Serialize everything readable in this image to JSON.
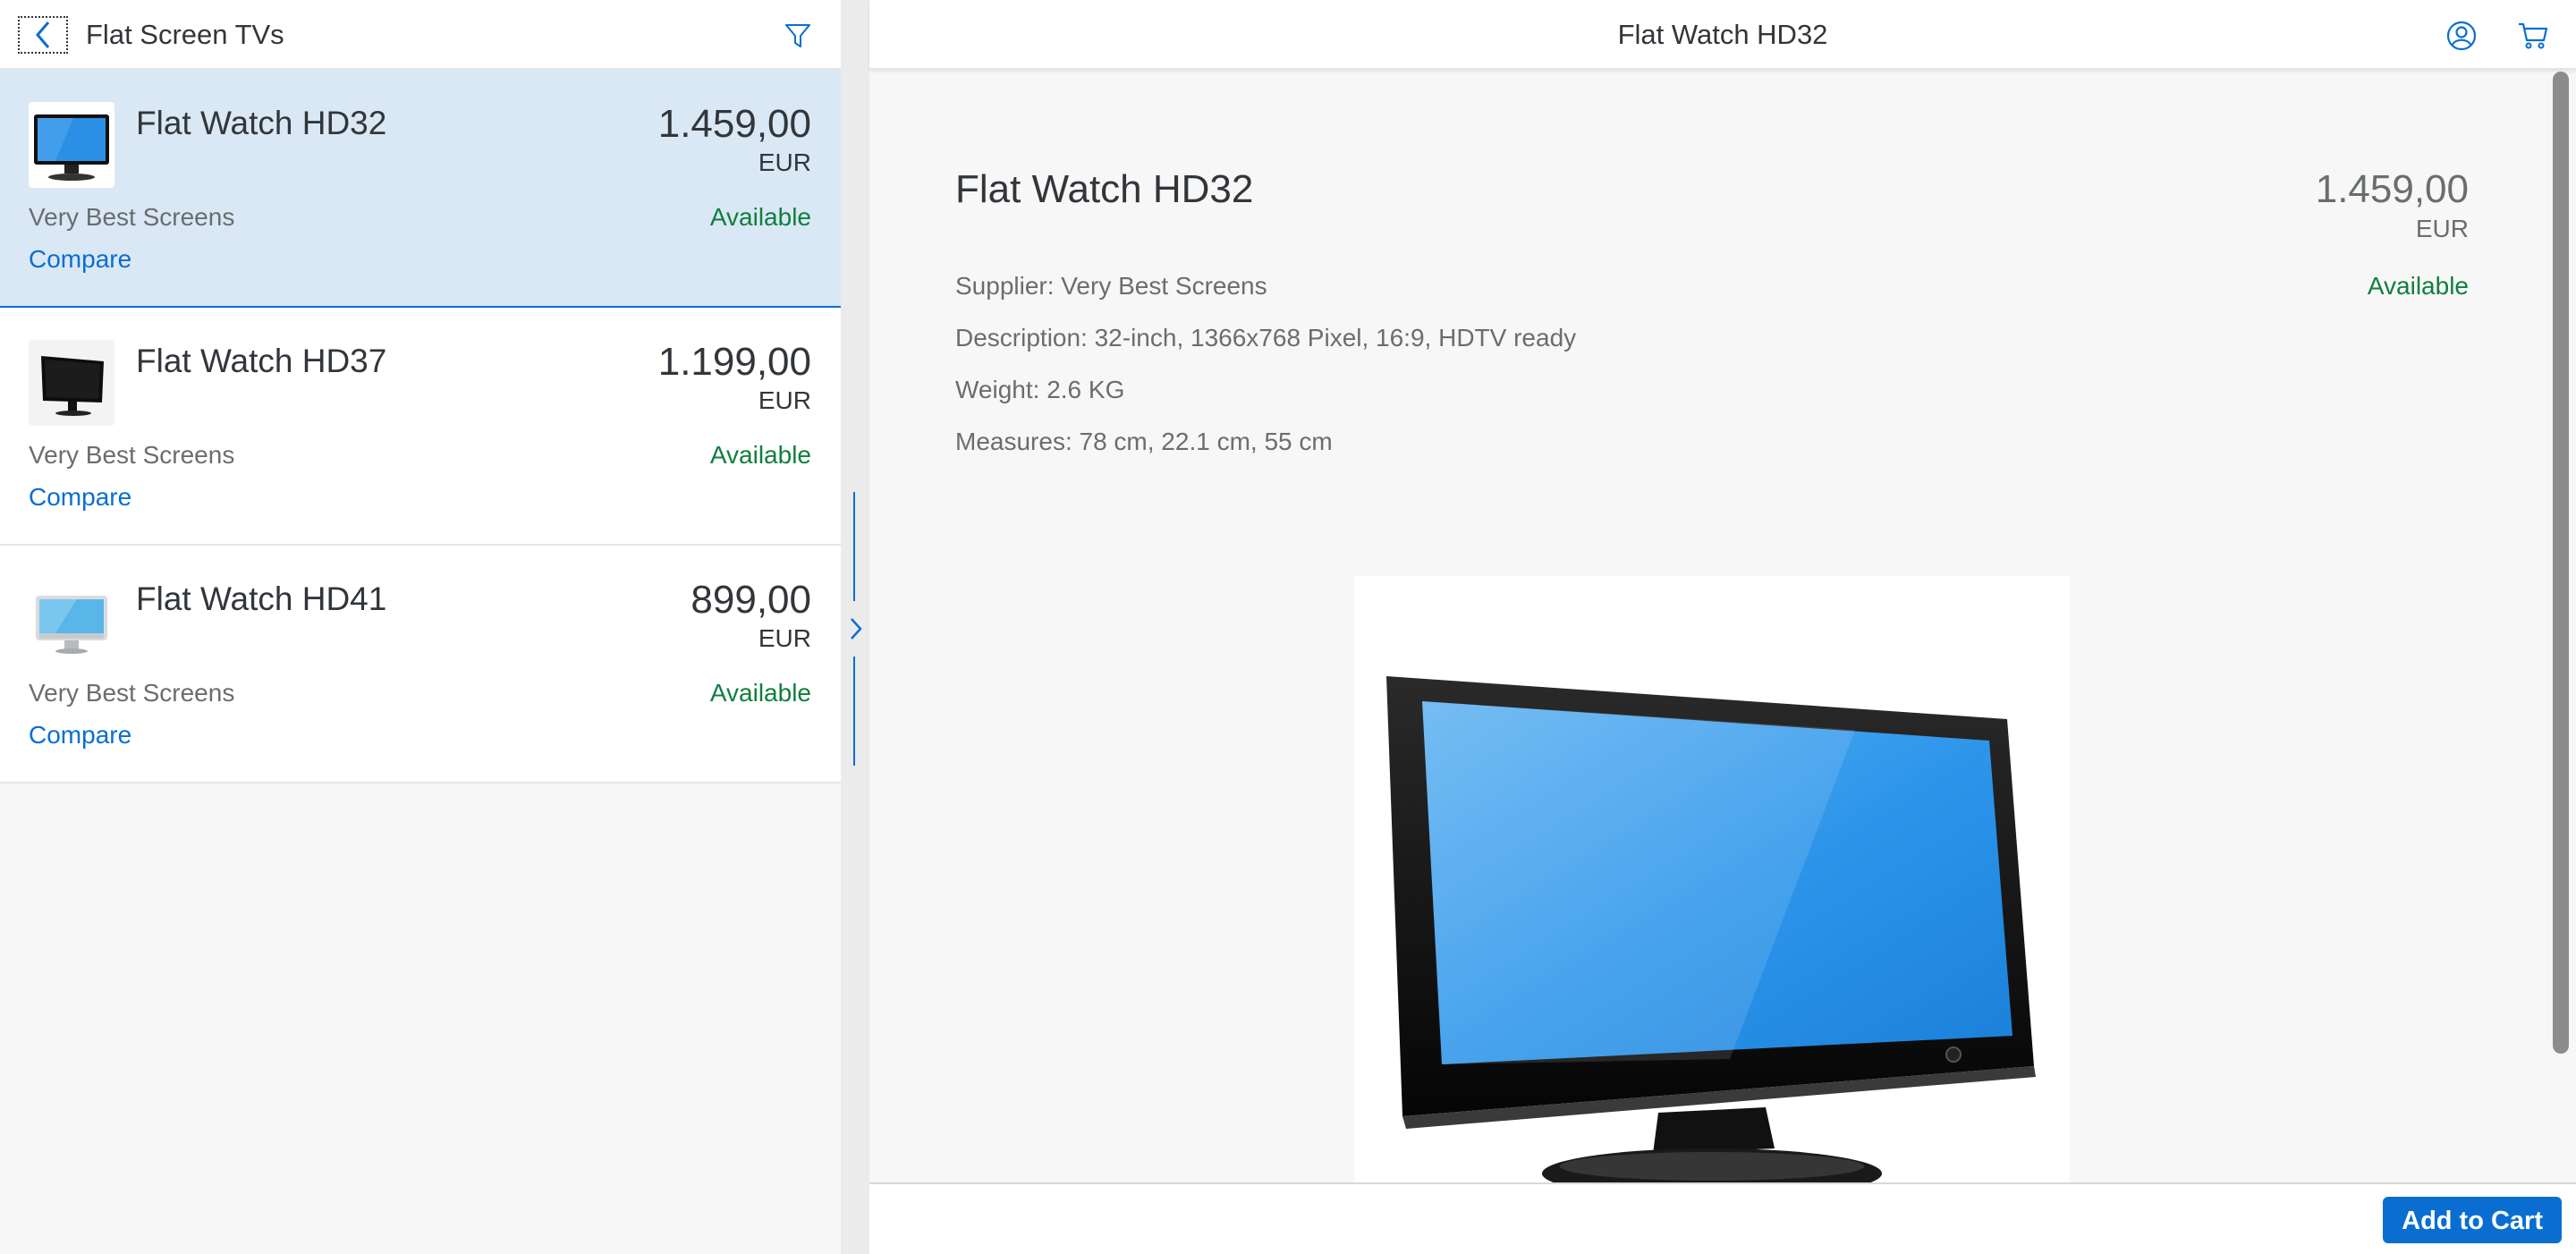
{
  "master": {
    "title": "Flat Screen TVs",
    "icons": {
      "back": "chevron-left-icon",
      "filter": "filter-icon"
    },
    "items": [
      {
        "name": "Flat Watch HD32",
        "price": "1.459,00",
        "currency": "EUR",
        "supplier": "Very Best Screens",
        "status": "Available",
        "compare": "Compare",
        "selected": true,
        "thumb": "monitor-blue"
      },
      {
        "name": "Flat Watch HD37",
        "price": "1.199,00",
        "currency": "EUR",
        "supplier": "Very Best Screens",
        "status": "Available",
        "compare": "Compare",
        "selected": false,
        "thumb": "monitor-black"
      },
      {
        "name": "Flat Watch HD41",
        "price": "899,00",
        "currency": "EUR",
        "supplier": "Very Best Screens",
        "status": "Available",
        "compare": "Compare",
        "selected": false,
        "thumb": "imac-style"
      }
    ]
  },
  "detail": {
    "header_title": "Flat Watch HD32",
    "icons": {
      "account": "user-icon",
      "cart": "cart-icon"
    },
    "title": "Flat Watch HD32",
    "price": "1.459,00",
    "currency": "EUR",
    "status": "Available",
    "attributes": {
      "supplier": "Supplier: Very Best Screens",
      "description": "Description: 32-inch, 1366x768 Pixel, 16:9, HDTV ready",
      "weight": "Weight: 2.6 KG",
      "measures": "Measures: 78 cm, 22.1 cm, 55 cm"
    },
    "add_to_cart": "Add to Cart"
  },
  "colors": {
    "accent": "#0a6ed1",
    "positive": "#107e3e",
    "selected_bg": "#dae8f5"
  }
}
